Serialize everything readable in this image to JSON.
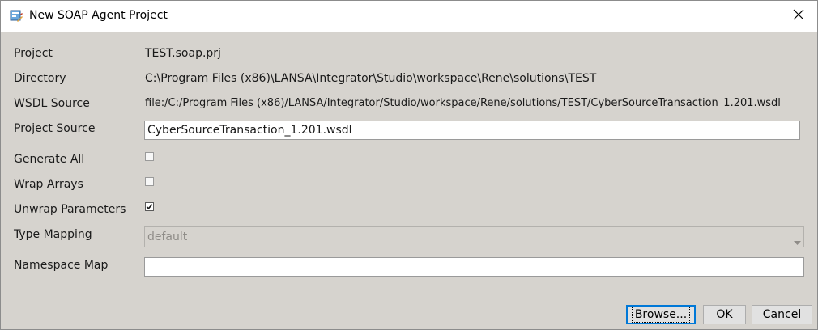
{
  "window": {
    "title": "New SOAP Agent Project",
    "app_icon": "soap-project-icon",
    "close_icon": "close-icon"
  },
  "form": {
    "project_label": "Project",
    "project_value": "TEST.soap.prj",
    "directory_label": "Directory",
    "directory_value": "C:\\Program Files (x86)\\LANSA\\Integrator\\Studio\\workspace\\Rene\\solutions\\TEST",
    "wsdl_source_label": "WSDL Source",
    "wsdl_source_value": "file:/C:/Program Files (x86)/LANSA/Integrator/Studio/workspace/Rene/solutions/TEST/CyberSourceTransaction_1.201.wsdl",
    "project_source_label": "Project Source",
    "project_source_value": "CyberSourceTransaction_1.201.wsdl",
    "generate_all_label": "Generate All",
    "generate_all_checked": false,
    "wrap_arrays_label": "Wrap Arrays",
    "wrap_arrays_checked": false,
    "unwrap_parameters_label": "Unwrap Parameters",
    "unwrap_parameters_checked": true,
    "type_mapping_label": "Type Mapping",
    "type_mapping_value": "default",
    "namespace_map_label": "Namespace Map",
    "namespace_map_value": ""
  },
  "buttons": {
    "browse_label": "Browse...",
    "ok_label": "OK",
    "cancel_label": "Cancel"
  },
  "colors": {
    "dialog_background": "#d6d3ce",
    "titlebar_background": "#ffffff",
    "default_button_border": "#0078d7"
  }
}
